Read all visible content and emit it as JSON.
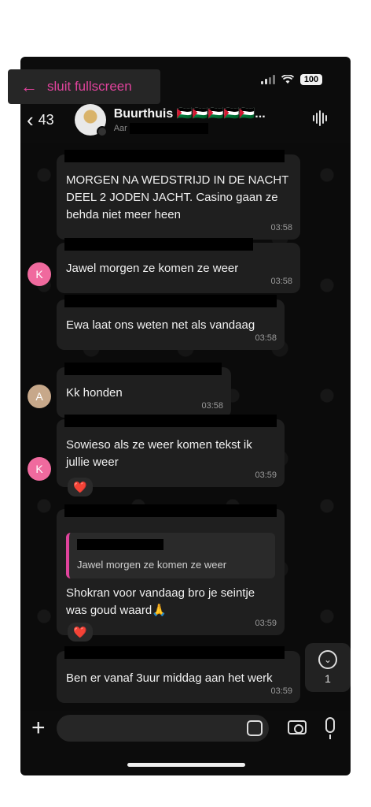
{
  "status_bar": {
    "battery": "100"
  },
  "fullscreen_banner": {
    "label": "sluit fullscreen"
  },
  "header": {
    "back_count": "43",
    "group_name": "Buurthuis 🇵🇸🇵🇸🇵🇸🇵🇸🇵🇸...",
    "subtitle_prefix": "Aar"
  },
  "messages": [
    {
      "text": "MORGEN NA WEDSTRIJD IN DE NACHT DEEL 2 JODEN JACHT. Casino gaan ze behda niet meer heen",
      "time": "03:58"
    },
    {
      "avatar": "K",
      "text": "Jawel morgen ze komen ze weer",
      "time": "03:58"
    },
    {
      "text": "Ewa laat ons weten net als vandaag",
      "time": "03:58"
    },
    {
      "avatar": "A",
      "text": "Kk honden",
      "time": "03:58"
    },
    {
      "avatar": "K",
      "text": "Sowieso als ze weer komen tekst ik jullie weer",
      "time": "03:59",
      "reaction": "❤️"
    },
    {
      "reply_to": "Jawel morgen ze komen ze weer",
      "text": "Shokran voor vandaag bro je seintje was goud waard🙏",
      "time": "03:59",
      "reaction": "❤️"
    },
    {
      "text": "Ben er vanaf 3uur middag aan het werk",
      "time": "03:59"
    }
  ],
  "scroll_button": {
    "count": "1"
  },
  "input": {
    "placeholder": ""
  },
  "colors": {
    "accent": "#e0439c",
    "bubble": "#1f1f1f",
    "background": "#0c0c0c"
  }
}
